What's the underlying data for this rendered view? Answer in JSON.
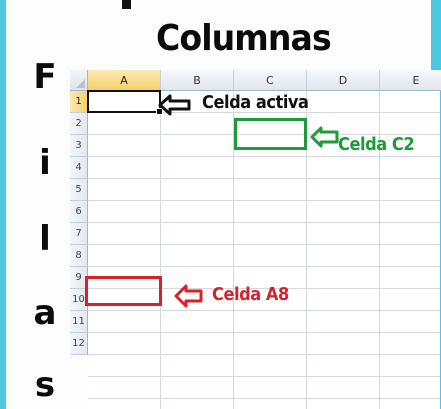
{
  "title": "Columnas",
  "side_label": [
    "F",
    "i",
    "l",
    "a",
    "s"
  ],
  "spreadsheet": {
    "columns": [
      "A",
      "B",
      "C",
      "D",
      "E"
    ],
    "rows": [
      "1",
      "2",
      "3",
      "4",
      "5",
      "6",
      "7",
      "8",
      "9",
      "10",
      "11",
      "12"
    ],
    "active_column": "A",
    "active_row": "1"
  },
  "annotations": {
    "active_cell": {
      "label": "Celda activa",
      "color": "#111111"
    },
    "cell_c2": {
      "label": "Celda C2",
      "color": "#1f9a3a"
    },
    "cell_a8": {
      "label": "Celda A8",
      "color": "#d4232b"
    }
  },
  "colors": {
    "frame": "#4ec8e0",
    "header_active": "#f7d06a"
  }
}
